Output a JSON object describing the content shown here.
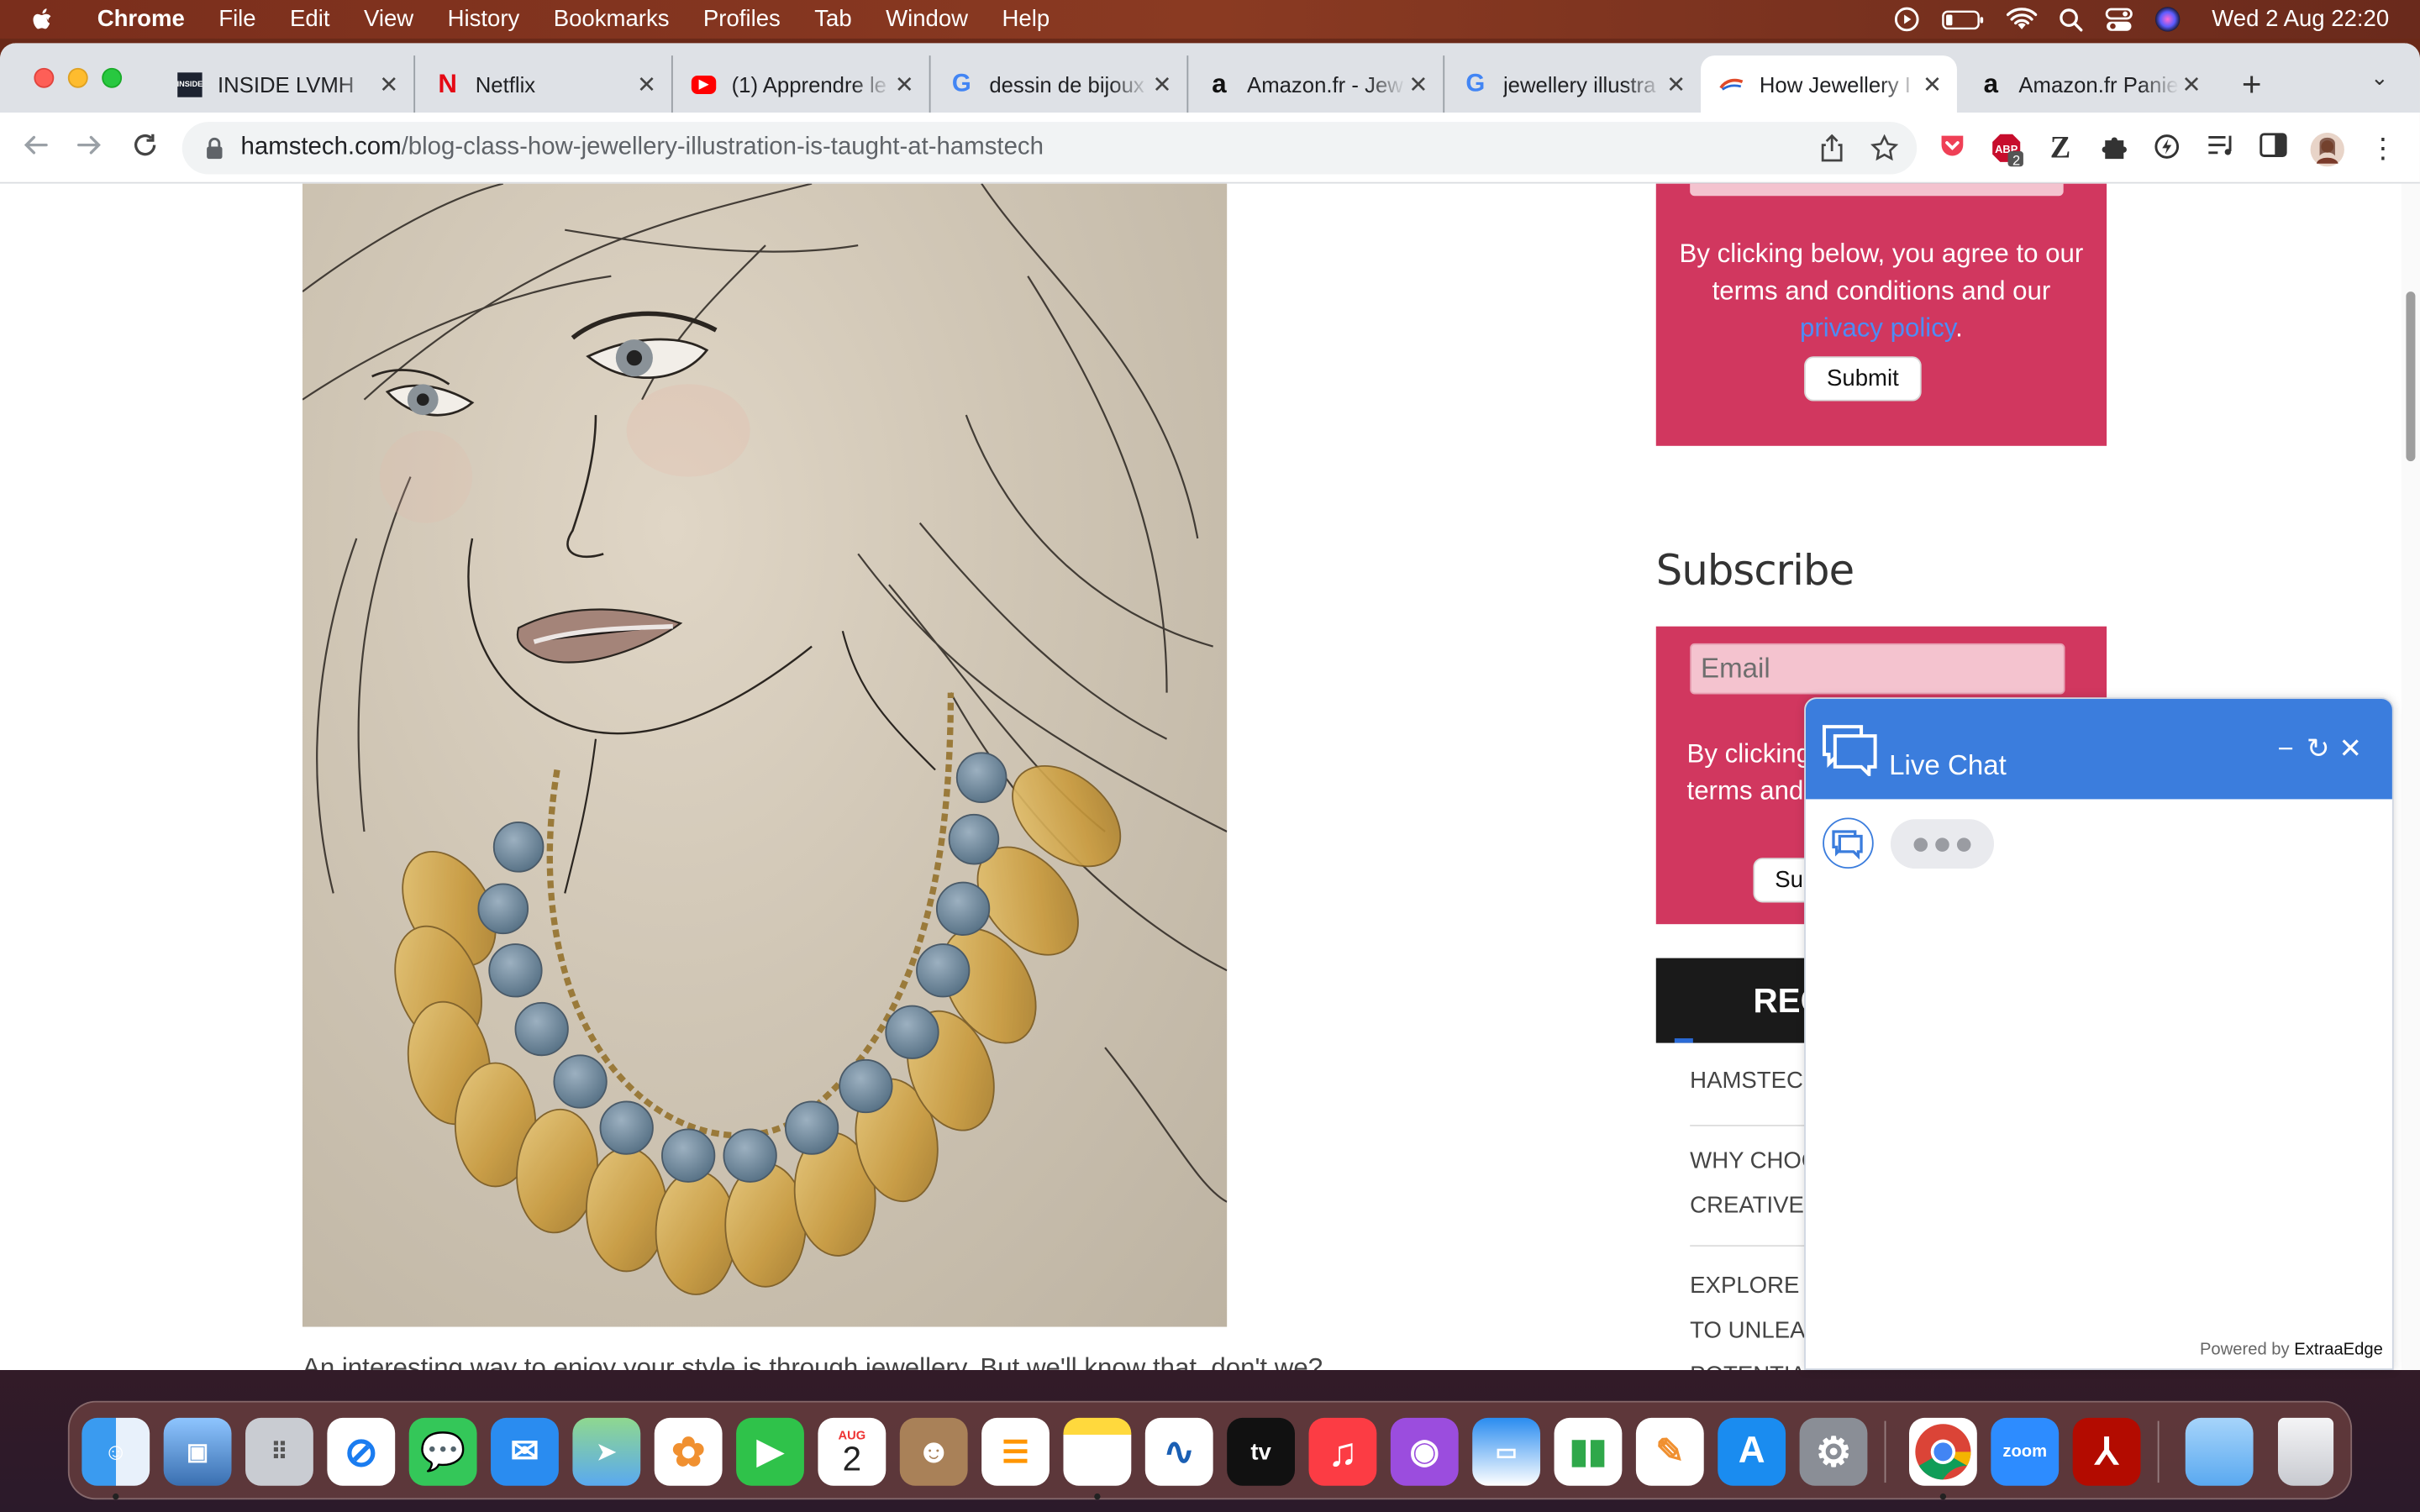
{
  "menubar": {
    "app": "Chrome",
    "items": [
      "File",
      "Edit",
      "View",
      "History",
      "Bookmarks",
      "Profiles",
      "Tab",
      "Window",
      "Help"
    ],
    "clock": "Wed 2 Aug  22:20"
  },
  "tabs": [
    {
      "label": "INSIDE LVMH",
      "favicon": "lvmh-icon"
    },
    {
      "label": "Netflix",
      "favicon": "netflix-icon"
    },
    {
      "label": "(1) Apprendre le",
      "favicon": "youtube-icon"
    },
    {
      "label": "dessin de bijoux",
      "favicon": "google-icon"
    },
    {
      "label": "Amazon.fr - Jew",
      "favicon": "amazon-icon"
    },
    {
      "label": "jewellery illustra",
      "favicon": "google-icon"
    },
    {
      "label": "How Jewellery I",
      "favicon": "hamstech-icon",
      "active": true
    },
    {
      "label": "Amazon.fr Panie",
      "favicon": "amazon-icon"
    }
  ],
  "address": {
    "domain": "hamstech.com",
    "path": "/blog-class-how-jewellery-illustration-is-taught-at-hamstech"
  },
  "extensions": {
    "abp_badge": "2"
  },
  "page": {
    "form1": {
      "agree_text": "By clicking below, you agree to our terms and conditions and our ",
      "privacy_link": "privacy policy",
      "period": ".",
      "submit": "Submit"
    },
    "subscribe_heading": "Subscribe",
    "form2": {
      "email_placeholder": "Email",
      "agree_partial_1": "By clicking",
      "agree_partial_2": "terms and c",
      "submit_partial": "Sul"
    },
    "recent_heading": "REC",
    "recent_items": [
      "HAMSTECH",
      "WHY CHOO",
      "CREATIVE F",
      "EXPLORE C",
      "TO UNLEAS",
      "POTENTIAL"
    ],
    "caption_cut": "An interesting way to enjoy your style is through jewellery. But we'll know that, don't we?"
  },
  "chat": {
    "title": "Live Chat",
    "powered_prefix": "Powered by ",
    "powered_brand": "ExtraaEdge"
  },
  "dock": {
    "calendar_month": "AUG",
    "calendar_day": "2",
    "tv_label": "tv",
    "zoom_label": "zoom"
  },
  "colors": {
    "accent_form": "#d1375f",
    "chat_blue": "#3b7ddd",
    "link_blue": "#4d8cf5"
  }
}
